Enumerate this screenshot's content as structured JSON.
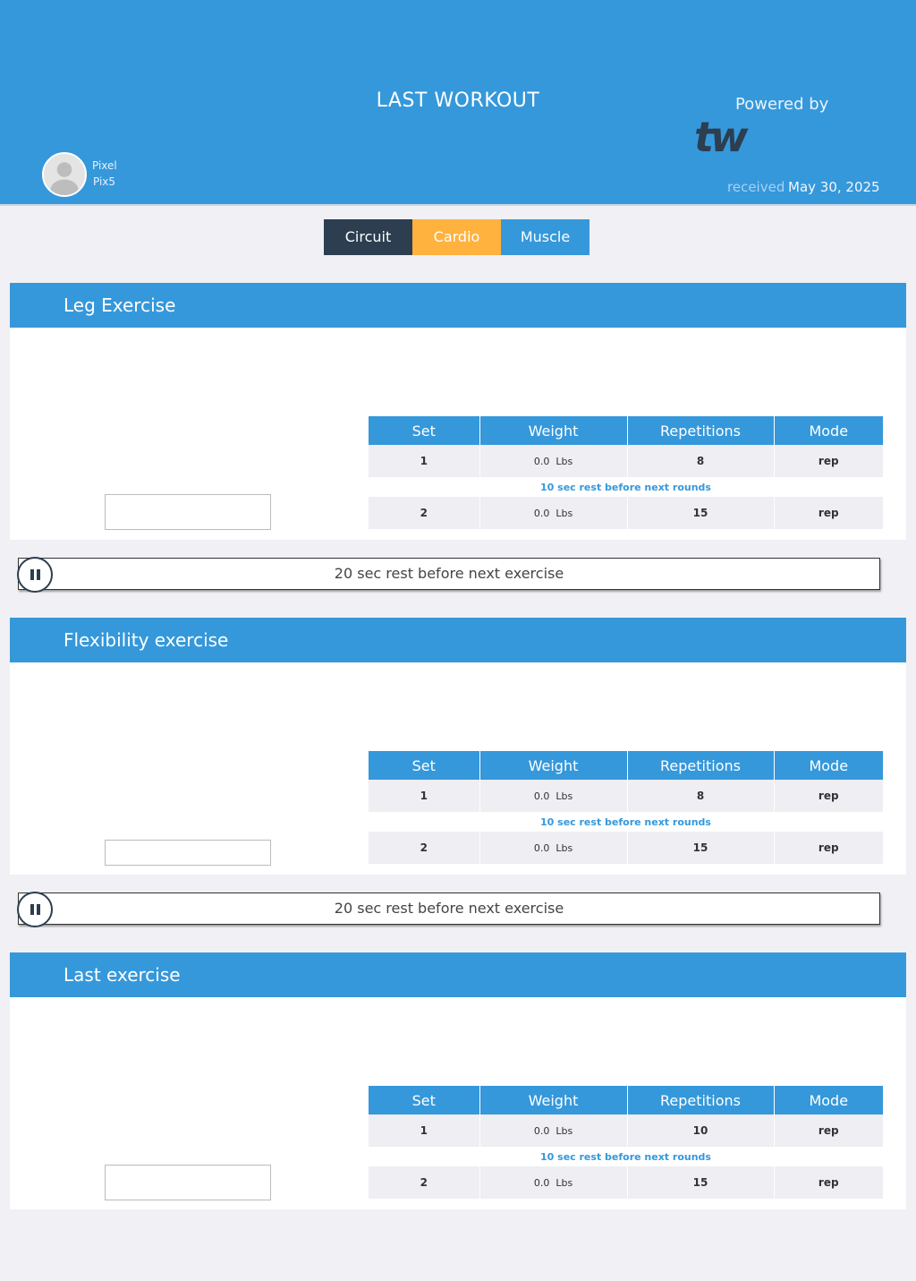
{
  "header": {
    "title": "LAST WORKOUT",
    "user_first": "Pixel",
    "user_last": "Pix5",
    "powered_by": "Powered by",
    "logo_text": "tw",
    "received_label": "received",
    "received_date": "May 30, 2025"
  },
  "tabs": [
    {
      "label": "Circuit",
      "color": "#2c3e50"
    },
    {
      "label": "Cardio",
      "color": "#ffb23d"
    },
    {
      "label": "Muscle",
      "color": "#3598db"
    }
  ],
  "table_headers": [
    "Set",
    "Weight",
    "Repetitions",
    "Mode"
  ],
  "exercises": [
    {
      "name": "Leg Exercise",
      "rows": [
        {
          "set": "1",
          "weight": "0.0",
          "unit": "Lbs",
          "reps": "8",
          "mode": "rep"
        },
        {
          "set": "2",
          "weight": "0.0",
          "unit": "Lbs",
          "reps": "15",
          "mode": "rep"
        }
      ],
      "round_rest": "10 sec rest before next rounds",
      "exercise_rest": "20 sec rest before next exercise"
    },
    {
      "name": "Flexibility exercise",
      "rows": [
        {
          "set": "1",
          "weight": "0.0",
          "unit": "Lbs",
          "reps": "8",
          "mode": "rep"
        },
        {
          "set": "2",
          "weight": "0.0",
          "unit": "Lbs",
          "reps": "15",
          "mode": "rep"
        }
      ],
      "round_rest": "10 sec rest before next rounds",
      "exercise_rest": "20 sec rest before next exercise"
    },
    {
      "name": "Last exercise",
      "rows": [
        {
          "set": "1",
          "weight": "0.0",
          "unit": "Lbs",
          "reps": "10",
          "mode": "rep"
        },
        {
          "set": "2",
          "weight": "0.0",
          "unit": "Lbs",
          "reps": "15",
          "mode": "rep"
        }
      ],
      "round_rest": "10 sec rest before next rounds"
    }
  ],
  "colors": {
    "accent": "#3598db",
    "dark": "#2c3e50",
    "orange": "#ffb23d"
  }
}
